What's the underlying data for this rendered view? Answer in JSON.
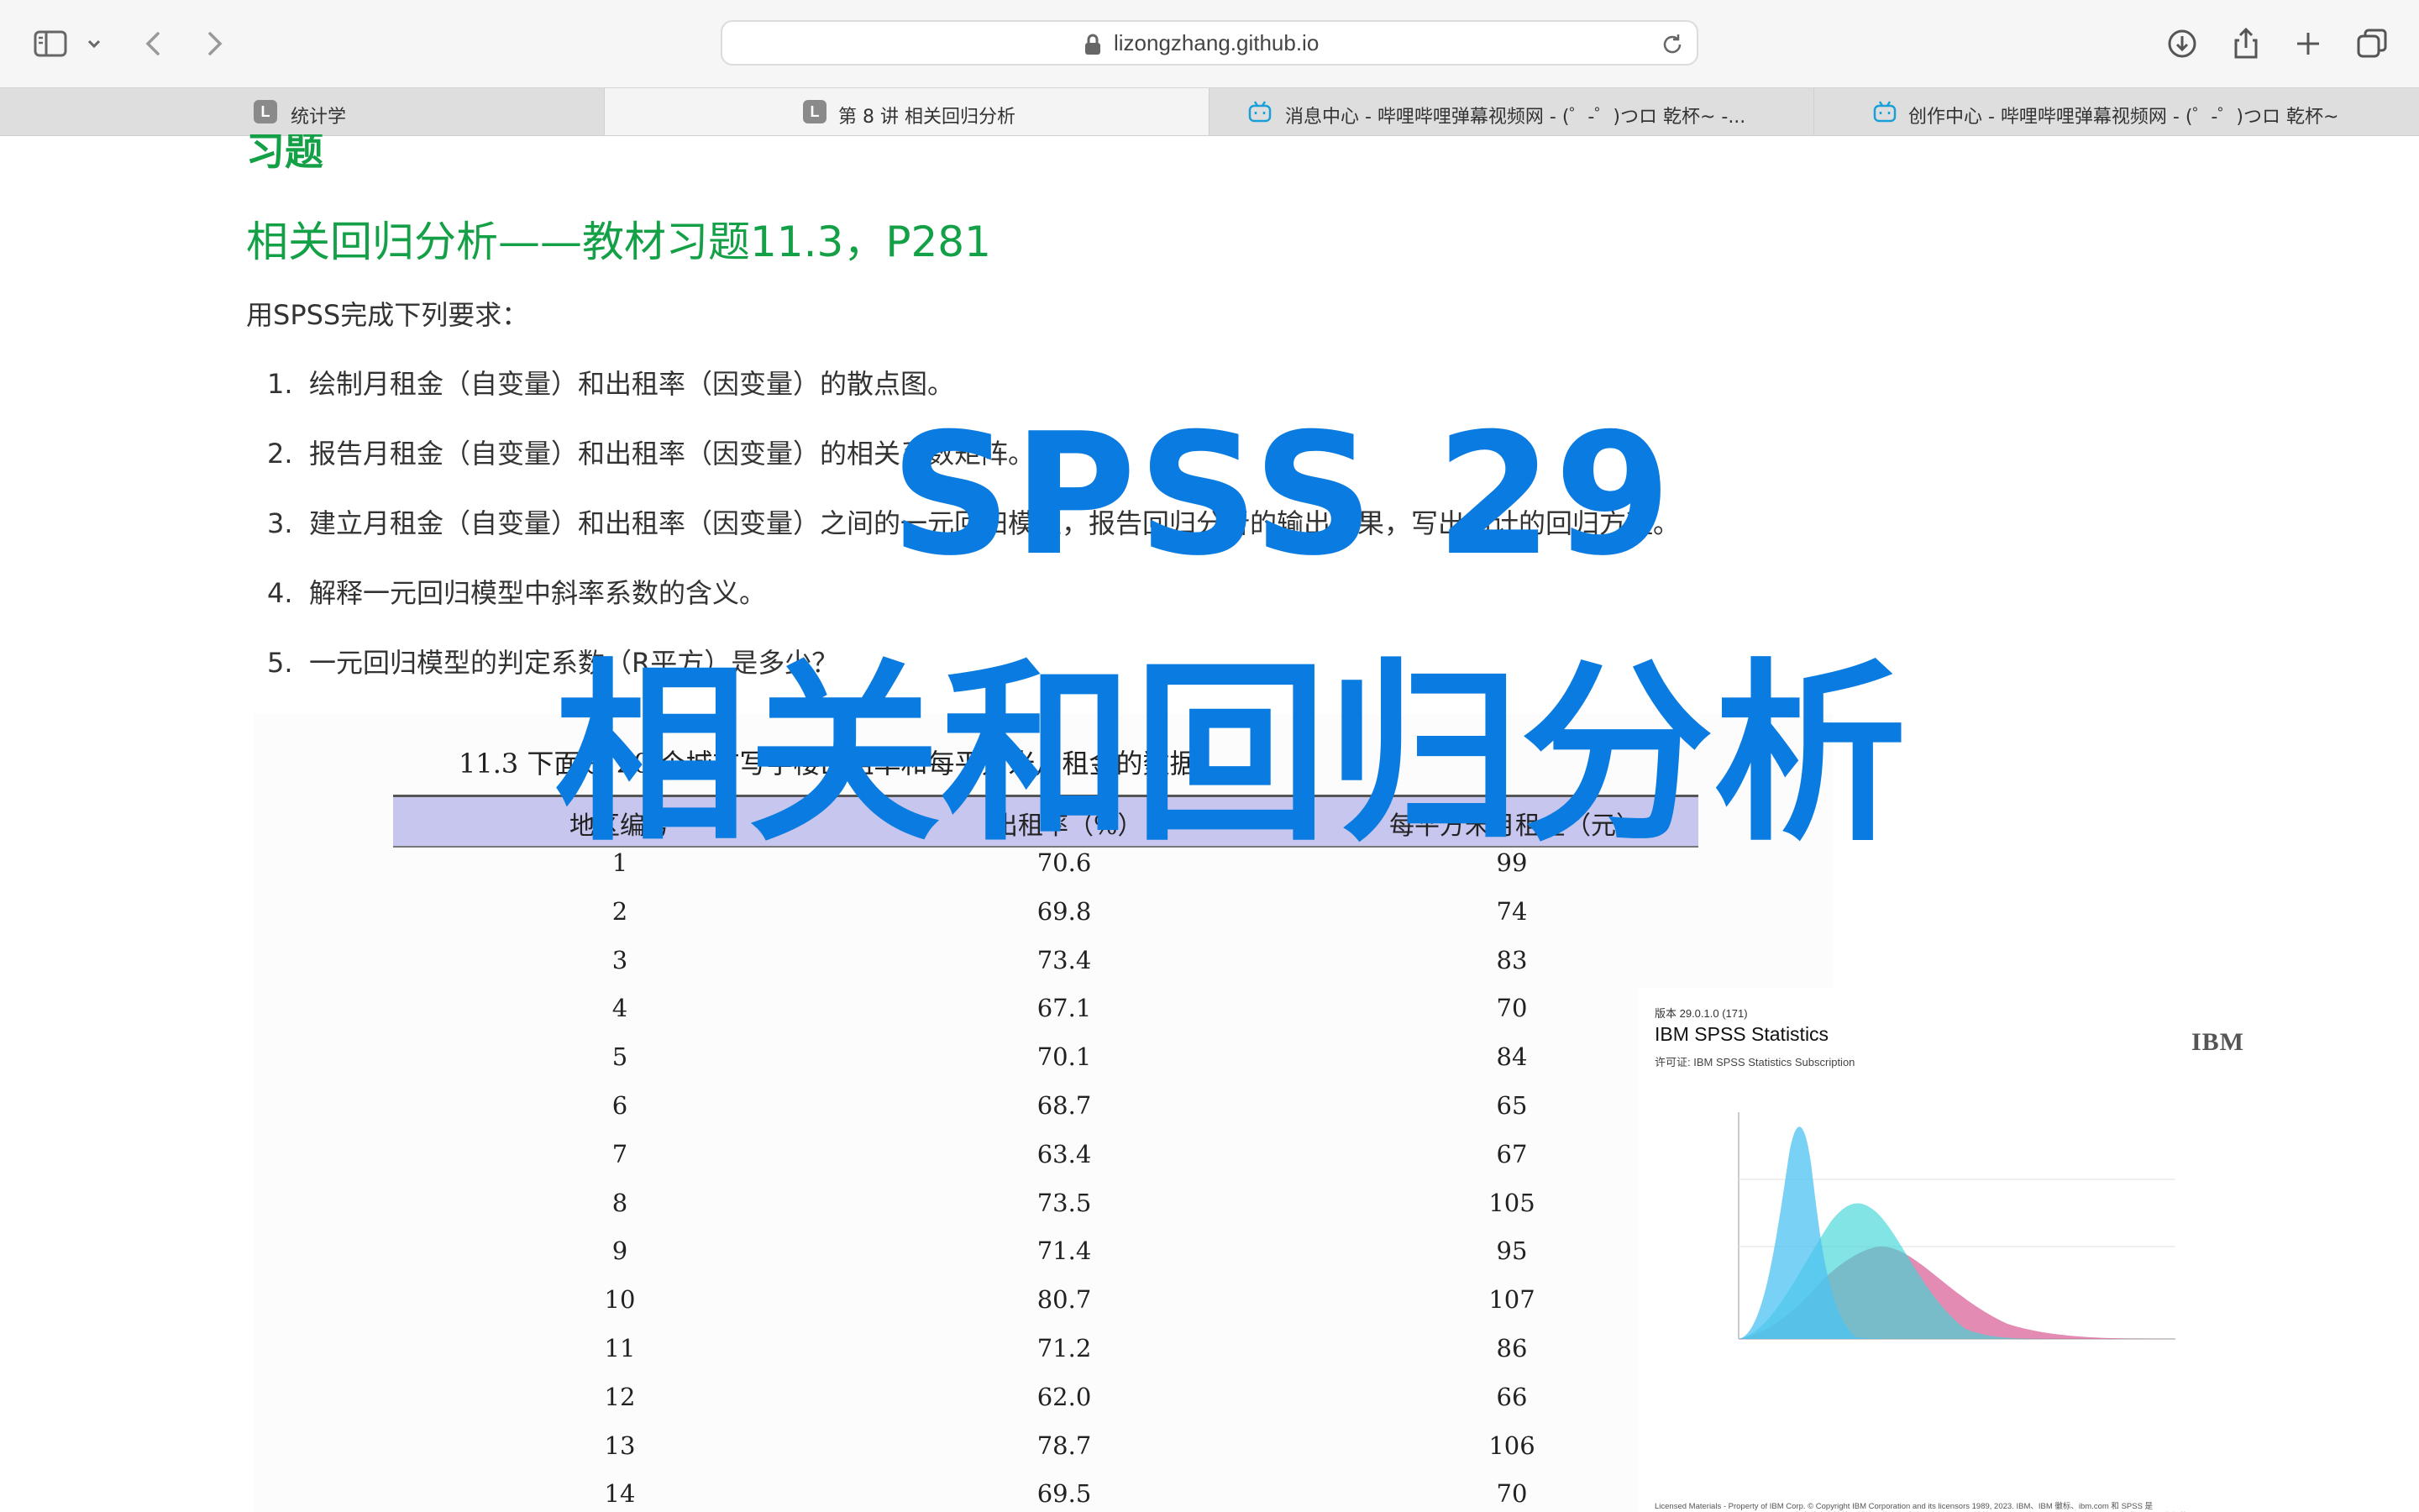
{
  "browser": {
    "url": "lizongzhang.github.io",
    "tabs": [
      {
        "label": "统计学",
        "favicon": "L",
        "active": false
      },
      {
        "label": "第 8 讲 相关回归分析",
        "favicon": "L",
        "active": true
      },
      {
        "label": "消息中心 - 哔哩哔哩弹幕视频网 - (゜-゜)つロ 乾杯~ -...",
        "favicon": "bilibili-icon",
        "active": false
      },
      {
        "label": "创作中心 - 哔哩哔哩弹幕视频网 - (゜-゜)つロ 乾杯~",
        "favicon": "bilibili-icon",
        "active": false
      }
    ]
  },
  "page": {
    "heading_top": "习题",
    "heading_sub": "相关回归分析——教材习题11.3，P281",
    "intro": "用SPSS完成下列要求：",
    "requirements": [
      {
        "num": "1.",
        "text": "绘制月租金（自变量）和出租率（因变量）的散点图。"
      },
      {
        "num": "2.",
        "text": "报告月租金（自变量）和出租率（因变量）的相关系数矩阵。"
      },
      {
        "num": "3.",
        "text": "建立月租金（自变量）和出租率（因变量）之间的一元回归模型，报告回归分析的输出结果，写出估计的回归方程。"
      },
      {
        "num": "4.",
        "text": "解释一元回归模型中斜率系数的含义。"
      },
      {
        "num": "5.",
        "text": "一元回归模型的判定系数（R平方）是多少？"
      }
    ],
    "table": {
      "caption": "11.3  下面是 20 个城市写字楼出租率和每平方米月租金的数据：",
      "headers": [
        "地区编号",
        "出租率（%）",
        "每平方米月租金（元）"
      ],
      "rows": [
        [
          "1",
          "70.6",
          "99"
        ],
        [
          "2",
          "69.8",
          "74"
        ],
        [
          "3",
          "73.4",
          "83"
        ],
        [
          "4",
          "67.1",
          "70"
        ],
        [
          "5",
          "70.1",
          "84"
        ],
        [
          "6",
          "68.7",
          "65"
        ],
        [
          "7",
          "63.4",
          "67"
        ],
        [
          "8",
          "73.5",
          "105"
        ],
        [
          "9",
          "71.4",
          "95"
        ],
        [
          "10",
          "80.7",
          "107"
        ],
        [
          "11",
          "71.2",
          "86"
        ],
        [
          "12",
          "62.0",
          "66"
        ],
        [
          "13",
          "78.7",
          "106"
        ],
        [
          "14",
          "69.5",
          "70"
        ]
      ]
    }
  },
  "overlay": {
    "line1": "SPSS 29",
    "line2": "相关和回归分析",
    "color": "#0a7be0"
  },
  "splash": {
    "version": "版本 29.0.1.0 (171)",
    "product": "IBM SPSS Statistics",
    "license": "许可证:  IBM SPSS Statistics Subscription",
    "logo": "IBM",
    "legal": "Licensed Materials - Property of IBM Corp. © Copyright IBM Corporation and its licensors 1989, 2023.  IBM、IBM 徽标、ibm.com 和 SPSS 是 International Business Machines Corp. 在全球许多管辖区域注册的商标或注册商标。 Web 地址 www.ibm.com/legal/copytrade.shtml 提供了 IBM 商标的最新列表。 其他产品和服务名称可能是 IBM 或其他公司的商标。 本程序依据本程序随附许可证 IBM 条款和条件许可使用。此许可证可能位于标识为 \"License\" 或 \"Non_IBM_License\"（如果适用）的程序目录文件夹或库中，或以印刷版许可协议提供。 在使用本程序之前，请仔细阅读本协议。 使用本程序即表明您同意这些条款。",
    "chart_colors": [
      "#4cc3f2",
      "#3fd6d6",
      "#d9649a"
    ]
  }
}
